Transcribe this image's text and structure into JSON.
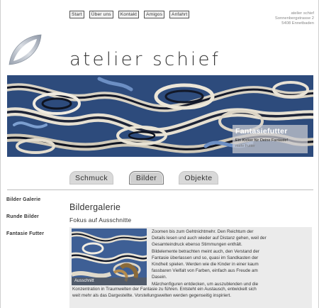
{
  "nav": {
    "items": [
      "Start",
      "Über uns",
      "Kontakt",
      "Amigos",
      "Anfahrt"
    ]
  },
  "address": {
    "line1": "atelier schief",
    "line2": "Sonnenbergstrasse 2",
    "line3": "5408 Ennetbaden"
  },
  "site": {
    "title": "atelier schief"
  },
  "hero": {
    "caption_title": "Fantasiefutter",
    "caption_subtitle": "Ein Kicker für Deine Fantasie!",
    "caption_more": "mehr Futter"
  },
  "categories": {
    "items": [
      "Schmuck",
      "Bilder",
      "Objekte"
    ],
    "active": "Bilder"
  },
  "sidebar": {
    "items": [
      "Bilder Galerie",
      "Runde Bilder",
      "Fantasie Futter"
    ]
  },
  "main": {
    "heading": "Bildergalerie",
    "subheading": "Fokus auf Ausschnitte",
    "thumb_label": "Ausschnitt",
    "lines_right": [
      "Zoomen bis zum Gehtnichtmehr. Den Reichtum der",
      "Details lesen und auch wieder auf Distanz gehen, weil der",
      "Gesamteindruck ebenso Stimmungen enthält.",
      "Bildelemente betrachten meint auch, den Verstand der",
      "Fantasie überlassen und so, quasi im Sandkasten der",
      "Kindheit spielen. Werden wie die Kinder in einer kaum",
      "fassbaren Vielfalt von Farben, einfach aus Freude am",
      "Dasein.",
      "Märchenfiguren entdecken, um auszublenden und die"
    ],
    "lines_full": [
      "Konzentration in Traumwelten der Fantasie zu führen. Entsteht ein Austausch, entwickelt sich",
      "weit mehr als das Dargestellte. Vorstellungswelten werden gegenseitig inspiriert."
    ]
  },
  "colors": {
    "hero_blue": "#2c4a7a",
    "text": "#333333",
    "panel": "#ebebeb"
  }
}
